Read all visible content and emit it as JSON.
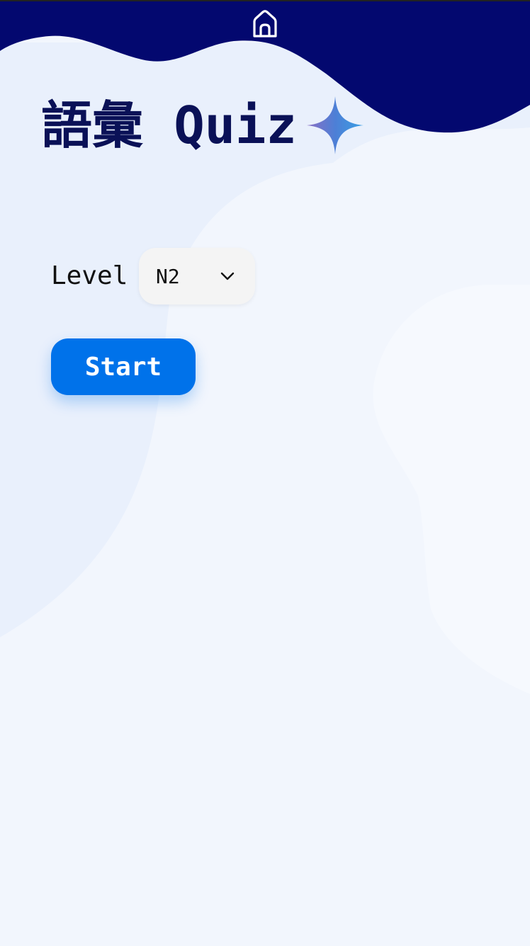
{
  "header": {
    "home_icon": "home-icon",
    "background_color": "#03086f"
  },
  "title": {
    "text": "語彙 Quiz",
    "color": "#0a1157",
    "icon": "sparkle-icon"
  },
  "level": {
    "label": "Level",
    "selected": "N2",
    "dropdown_icon": "chevron-down-icon"
  },
  "start": {
    "label": "Start",
    "color": "#0072ea"
  }
}
